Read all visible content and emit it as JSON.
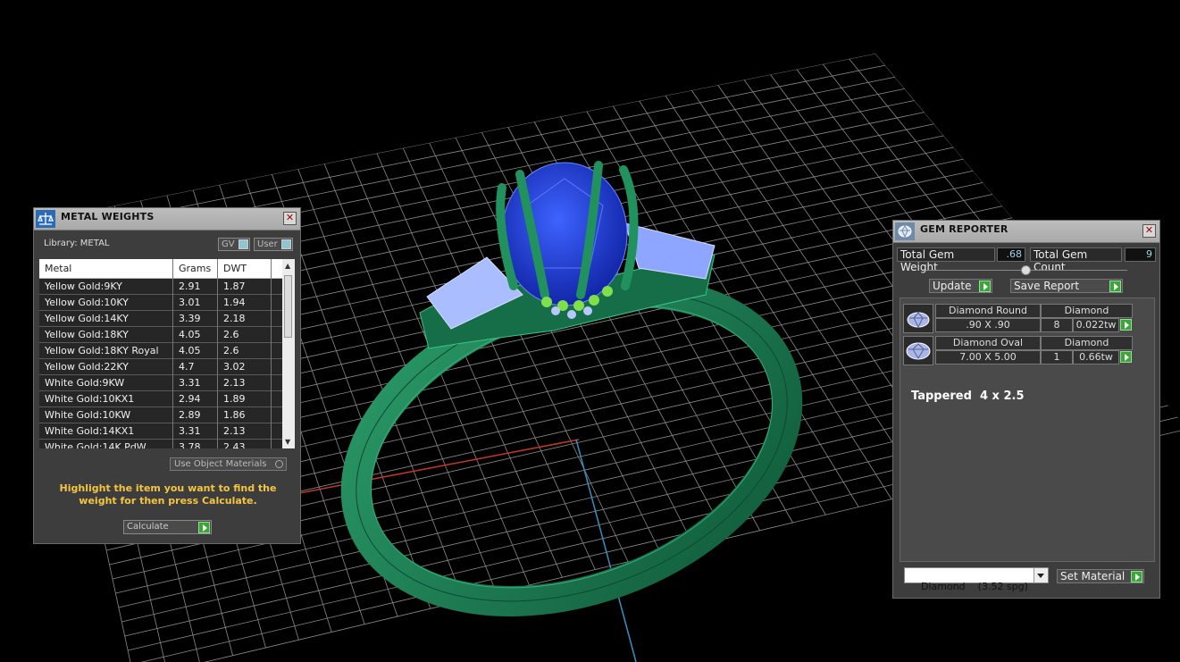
{
  "metal_weights": {
    "title": "METAL WEIGHTS",
    "library_label": "Library: METAL",
    "gv_label": "GV",
    "user_label": "User",
    "columns": [
      "Metal",
      "Grams",
      "DWT"
    ],
    "rows": [
      {
        "metal": "Yellow Gold:9KY",
        "grams": "2.91",
        "dwt": "1.87"
      },
      {
        "metal": "Yellow Gold:10KY",
        "grams": "3.01",
        "dwt": "1.94"
      },
      {
        "metal": "Yellow Gold:14KY",
        "grams": "3.39",
        "dwt": "2.18"
      },
      {
        "metal": "Yellow Gold:18KY",
        "grams": "4.05",
        "dwt": "2.6"
      },
      {
        "metal": "Yellow Gold:18KY Royal",
        "grams": "4.05",
        "dwt": "2.6"
      },
      {
        "metal": "Yellow Gold:22KY",
        "grams": "4.7",
        "dwt": "3.02"
      },
      {
        "metal": "White Gold:9KW",
        "grams": "3.31",
        "dwt": "2.13"
      },
      {
        "metal": "White Gold:10KX1",
        "grams": "2.94",
        "dwt": "1.89"
      },
      {
        "metal": "White Gold:10KW",
        "grams": "2.89",
        "dwt": "1.86"
      },
      {
        "metal": "White Gold:14KX1",
        "grams": "3.31",
        "dwt": "2.13"
      },
      {
        "metal": "White Gold:14K PdW",
        "grams": "3.78",
        "dwt": "2.43"
      }
    ],
    "use_object_materials": "Use Object Materials",
    "hint": "Highlight the item you want to find the weight for then press Calculate.",
    "calculate_label": "Calculate"
  },
  "gem_reporter": {
    "title": "GEM REPORTER",
    "total_weight_label": "Total Gem Weight",
    "total_weight_value": ".68",
    "total_count_label": "Total Gem Count",
    "total_count_value": "9",
    "update_label": "Update",
    "save_report_label": "Save Report",
    "gems": [
      {
        "name": "Diamond Round",
        "material": "Diamond",
        "size": ".90 X .90",
        "count": "8",
        "weight": "0.022tw"
      },
      {
        "name": "Diamond Oval",
        "material": "Diamond",
        "size": "7.00 X 5.00",
        "count": "1",
        "weight": "0.66tw"
      }
    ],
    "note": "Tappered  4 x 2.5",
    "material_select": "Diamond    (3.52 spg)",
    "set_material_label": "Set Material"
  },
  "colors": {
    "metal": "#1c7a52",
    "center_stone": "#1f3fd6",
    "baguette": "#9fb6ff",
    "grid": "#8a8a8a",
    "hint_text": "#f5c542"
  }
}
